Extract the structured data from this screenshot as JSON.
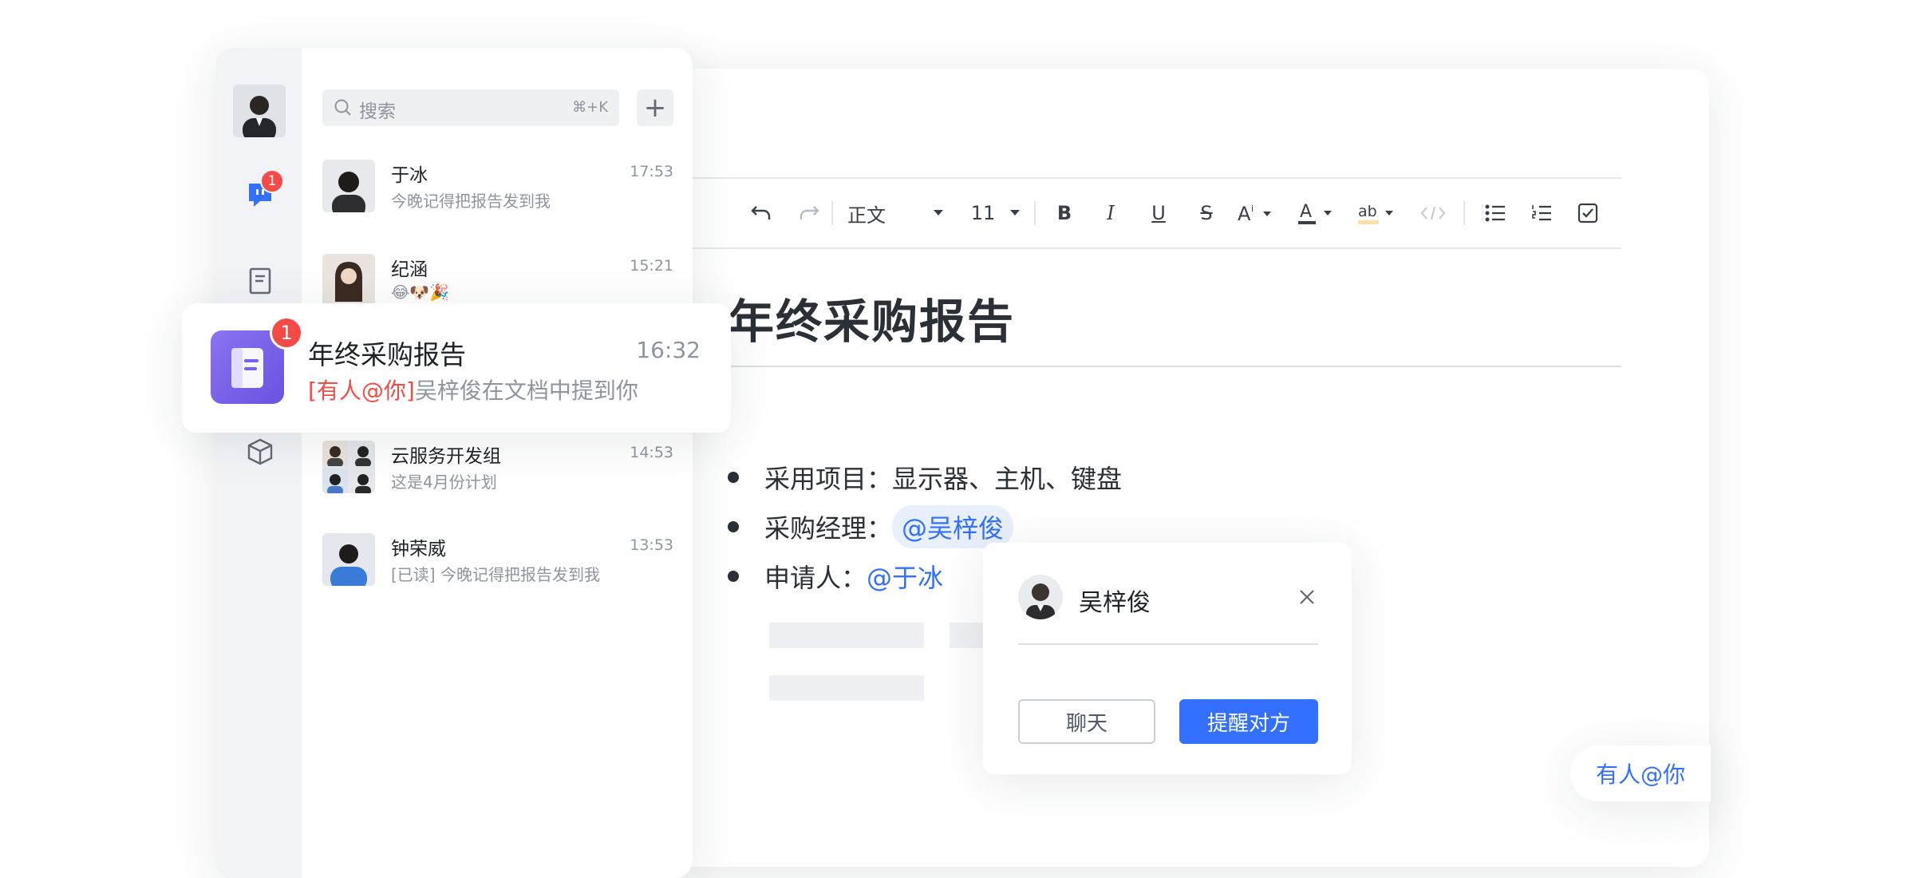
{
  "chat": {
    "search": {
      "placeholder": "搜索",
      "shortcut": "⌘+K"
    },
    "add_label": "+",
    "unread_badge": "1",
    "conversations": [
      {
        "name": "于冰",
        "time": "17:53",
        "preview": "今晚记得把报告发到我"
      },
      {
        "name": "纪涵",
        "time": "15:21",
        "preview": "😂🐶🎉"
      },
      {
        "name": "云服务开发组",
        "time": "14:53",
        "preview": "这是4月份计划"
      },
      {
        "name": "钟荣威",
        "time": "13:53",
        "preview": "[已读] 今晚记得把报告发到我"
      }
    ]
  },
  "notification": {
    "badge": "1",
    "title": "年终采购报告",
    "time": "16:32",
    "tag": "[有人@你]",
    "message": "吴梓俊在文档中提到你"
  },
  "doc": {
    "toolbar": {
      "style": "正文",
      "size": "11"
    },
    "title": "年终采购报告",
    "bullets": [
      {
        "label": "采用项目：",
        "value": "显示器、主机、键盘"
      },
      {
        "label": "采购经理：",
        "mention": "@吴梓俊"
      },
      {
        "label": "申请人：",
        "mention": "@于冰"
      }
    ]
  },
  "popup": {
    "name": "吴梓俊",
    "chat_label": "聊天",
    "remind_label": "提醒对方"
  },
  "at_pill": "有人@你",
  "colors": {
    "accent": "#3370ff",
    "alert": "#f54a45",
    "app_icon": "#7b62ea"
  }
}
